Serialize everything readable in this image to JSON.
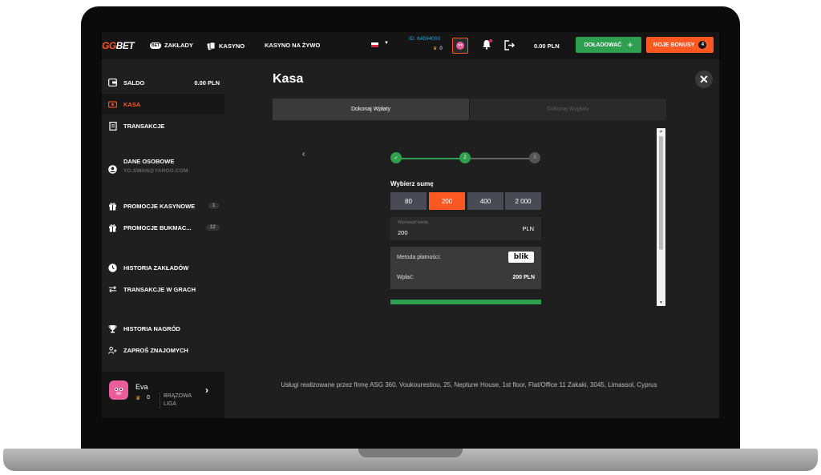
{
  "header": {
    "logo": {
      "gg": "GG",
      "bet": "BET"
    },
    "nav": [
      {
        "icon": "bet-pill-icon",
        "label": "ZAKŁADY",
        "pill": "BET"
      },
      {
        "icon": "cards-icon",
        "label": "KASYNO"
      },
      {
        "label": "KASYNO NA ŻYWO"
      }
    ],
    "user_id": "ID: 64594003",
    "crown_count": "0",
    "balance": "0.00 PLN",
    "deposit_button": "DOŁADOWAĆ",
    "bonus_button": "MOJE BONUSY",
    "bonus_count": "4"
  },
  "sidebar": {
    "saldo_label": "SALDO",
    "saldo_value": "0.00 PLN",
    "kasa": "KASA",
    "transakcje": "TRANSAKCJE",
    "dane_osobowe": "DANE OSOBOWE",
    "email": "YO.SWAN@YAHOO.COM",
    "promocje_kasynowe": "PROMOCJE KASYNOWE",
    "promocje_kasynowe_count": "1",
    "promocje_bukmac": "PROMOCJE BUKMAC...",
    "promocje_bukmac_count": "12",
    "historia_zakladow": "HISTORIA ZAKŁADÓW",
    "transakcje_w_grach": "TRANSAKCJE W GRACH",
    "historia_nagrod": "HISTORIA NAGRÓD",
    "zapros_znajomych": "ZAPROŚ ZNAJOMYCH",
    "profile": {
      "name": "Eva",
      "level_count": "0",
      "league_line1": "BRĄZOWA",
      "league_line2": "LIGA"
    }
  },
  "main": {
    "title": "Kasa",
    "tabs": [
      "Dokonaj Wpłaty",
      "Dokonaj Wypłaty"
    ],
    "steps": [
      "✓",
      "2",
      "3"
    ],
    "choose_amount": "Wybierz sumę",
    "amounts": [
      "80",
      "200",
      "400",
      "2 000"
    ],
    "selected_amount": "200",
    "custom_placeholder": "Wprowadź kwotę",
    "custom_value": "200",
    "currency": "PLN",
    "payment_method_label": "Metoda płatności:",
    "payment_method": "blik",
    "deposit_label": "Wpłać:",
    "deposit_value": "200 PLN",
    "footer": "Usługi realizowane przez firmę ASG 360. Voukourestiou, 25, Neptune House, 1st floor, Flat/Office 11 Zakaki, 3045, Limassol, Cyprus"
  },
  "colors": {
    "accent": "#ff5722",
    "success": "#2e9e4f",
    "background": "#1f1f1f"
  }
}
